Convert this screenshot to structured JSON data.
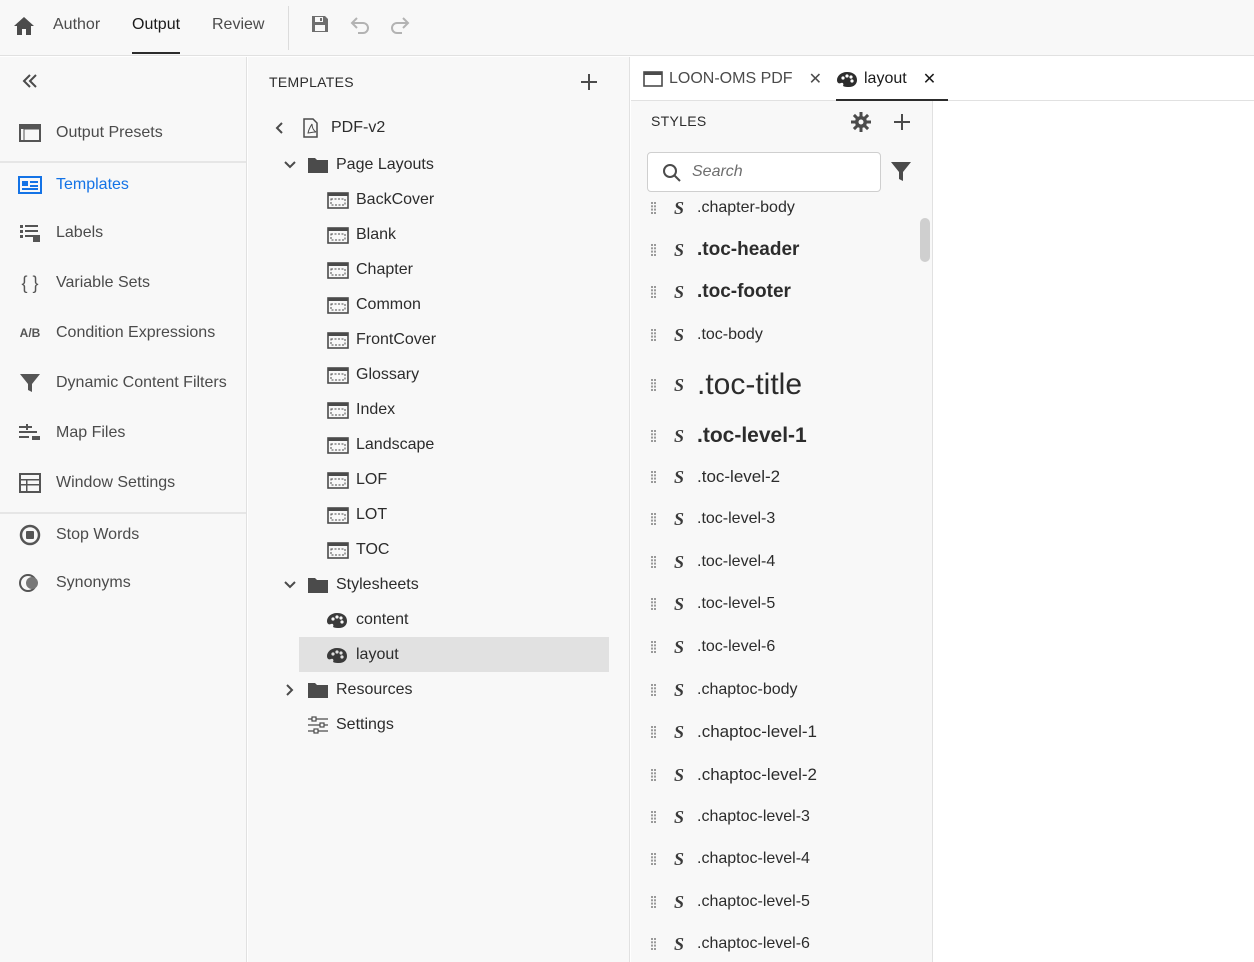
{
  "topnav": {
    "tabs": [
      {
        "label": "Author"
      },
      {
        "label": "Output"
      },
      {
        "label": "Review"
      }
    ]
  },
  "leftnav": {
    "items": [
      {
        "label": "Output Presets",
        "icon": "output-presets-icon"
      },
      {
        "label": "Templates",
        "icon": "templates-icon"
      },
      {
        "label": "Labels",
        "icon": "labels-icon"
      },
      {
        "label": "Variable Sets",
        "icon": "braces-icon",
        "glyph": "{ }"
      },
      {
        "label": "Condition Expressions",
        "icon": "ab-icon",
        "glyph": "A/B"
      },
      {
        "label": "Dynamic Content Filters",
        "icon": "filter-icon"
      },
      {
        "label": "Map Files",
        "icon": "map-files-icon"
      },
      {
        "label": "Window Settings",
        "icon": "window-settings-icon"
      },
      {
        "label": "Stop Words",
        "icon": "stop-words-icon"
      },
      {
        "label": "Synonyms",
        "icon": "synonyms-icon"
      }
    ],
    "active_color": "#1473e6"
  },
  "templates": {
    "title": "TEMPLATES",
    "root": "PDF-v2",
    "page_layouts_label": "Page Layouts",
    "page_layouts": [
      "BackCover",
      "Blank",
      "Chapter",
      "Common",
      "FrontCover",
      "Glossary",
      "Index",
      "Landscape",
      "LOF",
      "LOT",
      "TOC"
    ],
    "stylesheets_label": "Stylesheets",
    "stylesheets": [
      "content",
      "layout"
    ],
    "resources_label": "Resources",
    "settings_label": "Settings"
  },
  "doc_tabs": [
    {
      "label": "LOON-OMS PDF",
      "close": "✕"
    },
    {
      "label": "layout",
      "close": "✕"
    }
  ],
  "styles_panel": {
    "title": "STYLES",
    "search_placeholder": "Search",
    "style_marker": "S",
    "items": [
      {
        "name": ".chapter-body"
      },
      {
        "name": ".toc-header"
      },
      {
        "name": ".toc-footer"
      },
      {
        "name": ".toc-body"
      },
      {
        "name": ".toc-title"
      },
      {
        "name": ".toc-level-1"
      },
      {
        "name": ".toc-level-2"
      },
      {
        "name": ".toc-level-3"
      },
      {
        "name": ".toc-level-4"
      },
      {
        "name": ".toc-level-5"
      },
      {
        "name": ".toc-level-6"
      },
      {
        "name": ".chaptoc-body"
      },
      {
        "name": ".chaptoc-level-1"
      },
      {
        "name": ".chaptoc-level-2"
      },
      {
        "name": ".chaptoc-level-3"
      },
      {
        "name": ".chaptoc-level-4"
      },
      {
        "name": ".chaptoc-level-5"
      },
      {
        "name": ".chaptoc-level-6"
      }
    ]
  }
}
